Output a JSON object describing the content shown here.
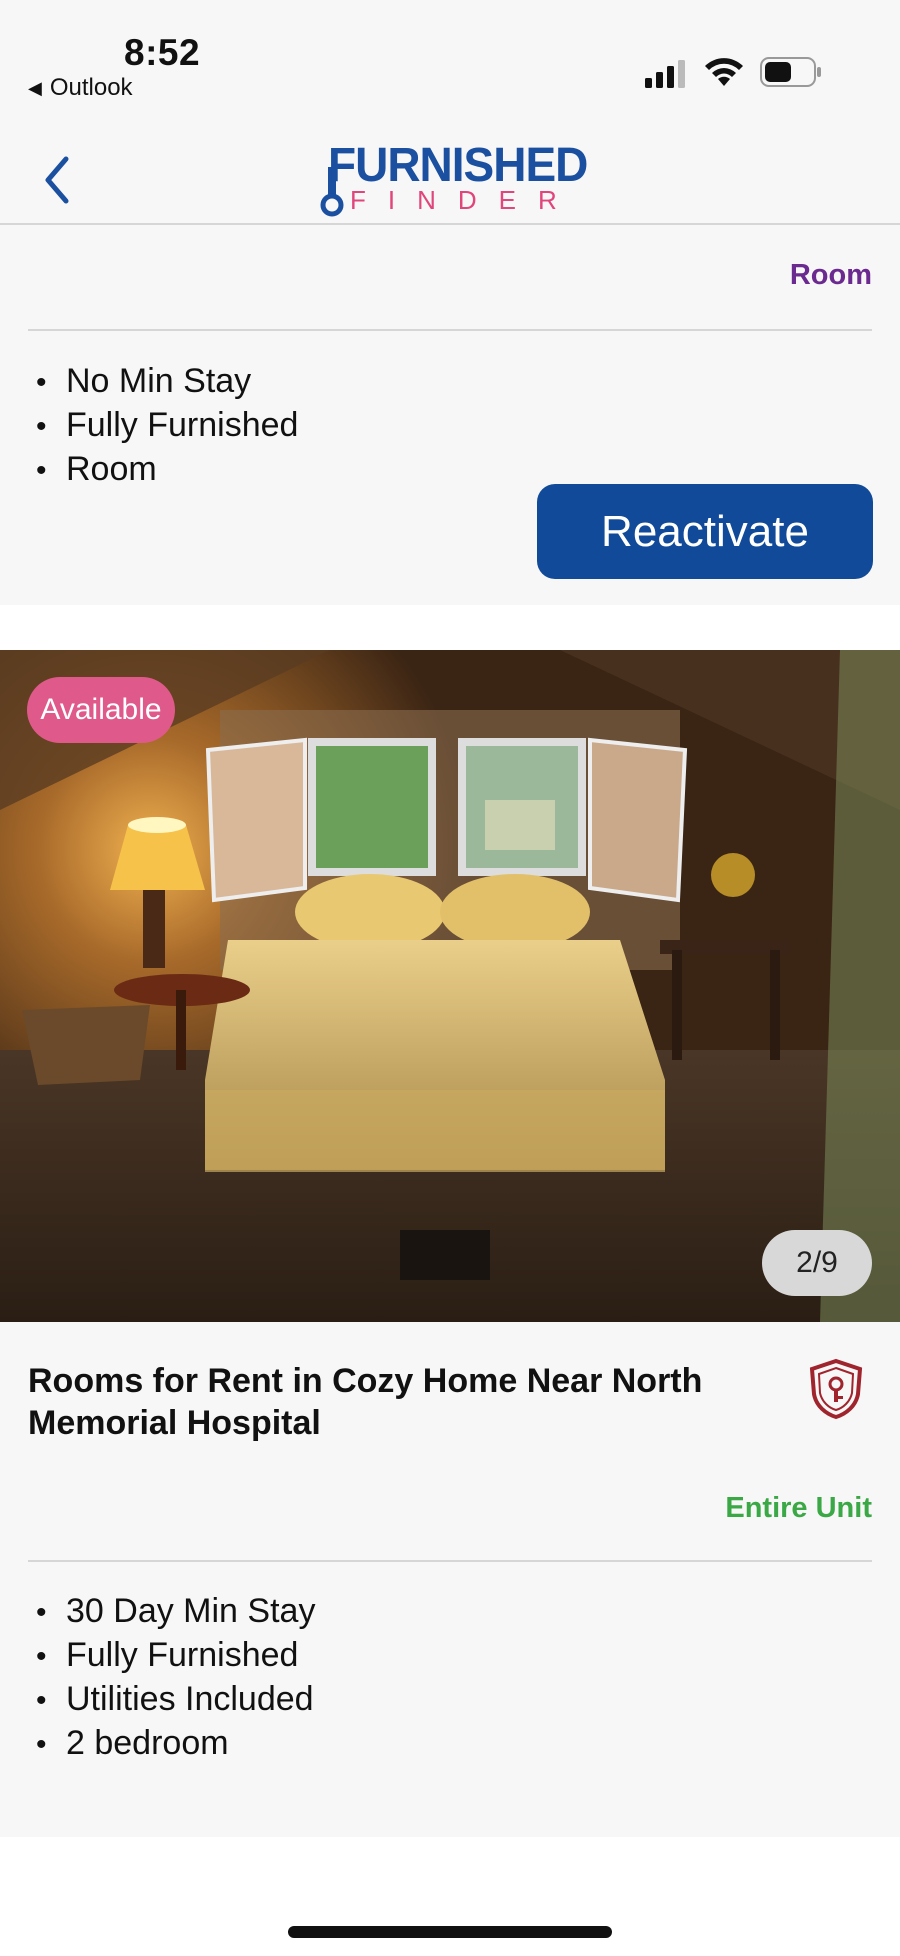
{
  "status_bar": {
    "time": "8:52",
    "back_app": "Outlook"
  },
  "nav": {
    "logo_top": "FURNISHED",
    "logo_bottom": "FINDER",
    "brand_blue": "#1b4fa0",
    "brand_pink": "#e0457b"
  },
  "listing_1": {
    "type": "Room",
    "features": [
      "No Min Stay",
      "Fully Furnished",
      "Room"
    ],
    "reactivate_label": "Reactivate"
  },
  "listing_2": {
    "availability": "Available",
    "photo_counter": "2/9",
    "title": "Rooms for Rent in Cozy  Home Near North Memorial Hospital",
    "type": "Entire Unit",
    "features": [
      "30 Day Min Stay",
      "Fully Furnished",
      "Utilities Included",
      "2 bedroom"
    ]
  },
  "colors": {
    "room_type": "#6b2a8f",
    "entire_unit": "#3aa845",
    "button": "#104a98",
    "badge": "#df5a8a"
  }
}
